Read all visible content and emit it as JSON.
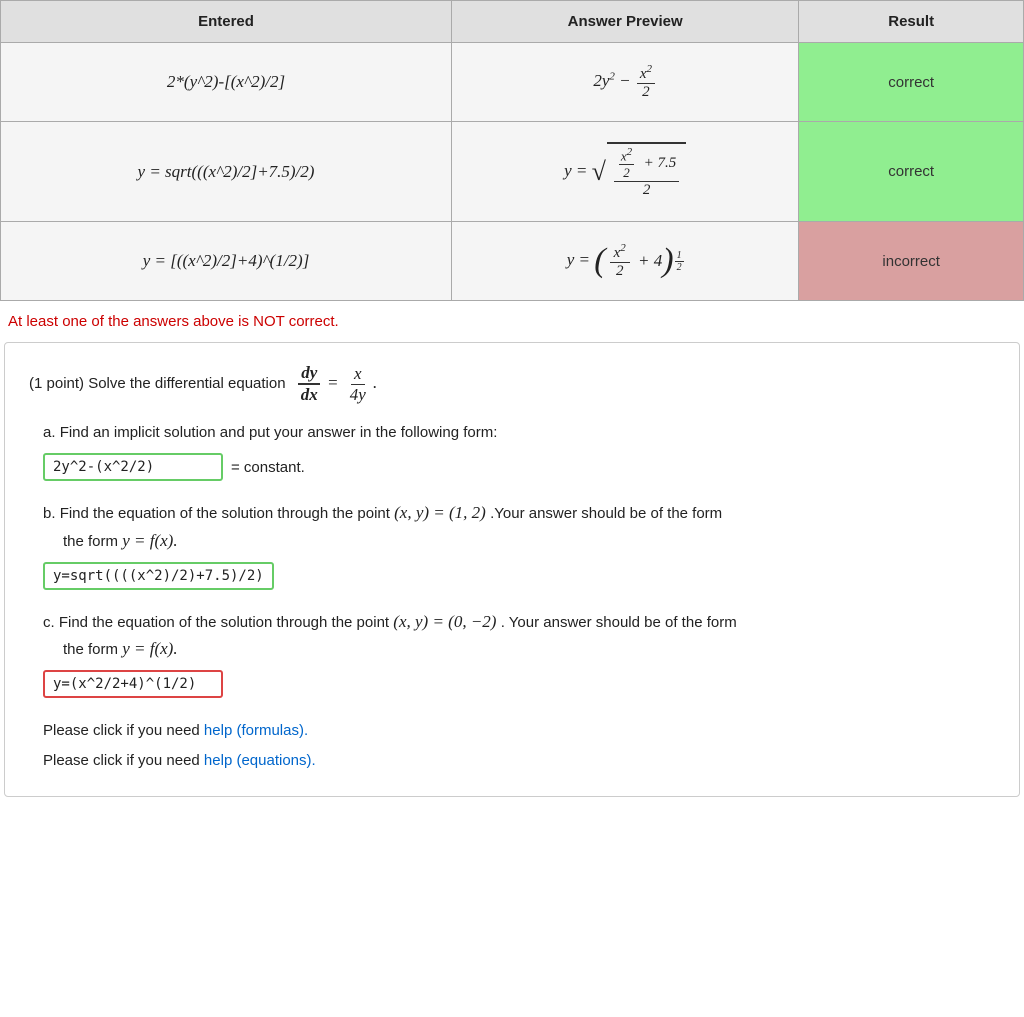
{
  "table": {
    "headers": [
      "Entered",
      "Answer Preview",
      "Result"
    ],
    "rows": [
      {
        "entered": "2*(y^2)-[(x^2)/2]",
        "preview_html": "row1",
        "result": "correct",
        "result_class": "result-correct"
      },
      {
        "entered": "y = sqrt(((x^2)/2]+7.5)/2)",
        "preview_html": "row2",
        "result": "correct",
        "result_class": "result-correct"
      },
      {
        "entered": "y = [((x^2)/2]+4)^(1/2)]",
        "preview_html": "row3",
        "result": "incorrect",
        "result_class": "result-incorrect"
      }
    ]
  },
  "status_message": "At least one of the answers above is NOT correct.",
  "problem": {
    "points": "(1 point)",
    "intro_text": "Solve the differential equation",
    "parts": {
      "a": {
        "label": "a.",
        "text": "Find an implicit solution and put your answer in the following form:",
        "input_value": "2y^2-(x^2/2)",
        "suffix": "= constant."
      },
      "b": {
        "label": "b.",
        "text_prefix": "Find the equation of the solution through the point",
        "point": "(x, y) = (1, 2)",
        "text_suffix": ".Your answer should be of the form",
        "form": "y = f(x).",
        "input_value": "y=sqrt((((x^2)/2)+7.5)/2)"
      },
      "c": {
        "label": "c.",
        "text_prefix": "Find the equation of the solution through the point",
        "point": "(x, y) = (0, −2)",
        "text_suffix": ". Your answer should be of the form",
        "form": "y = f(x).",
        "input_value": "y=(x^2/2+4)^(1/2)"
      }
    },
    "help1_prefix": "Please click if you need ",
    "help1_link": "help (formulas).",
    "help2_prefix": "Please click if you need ",
    "help2_link": "help (equations)."
  }
}
